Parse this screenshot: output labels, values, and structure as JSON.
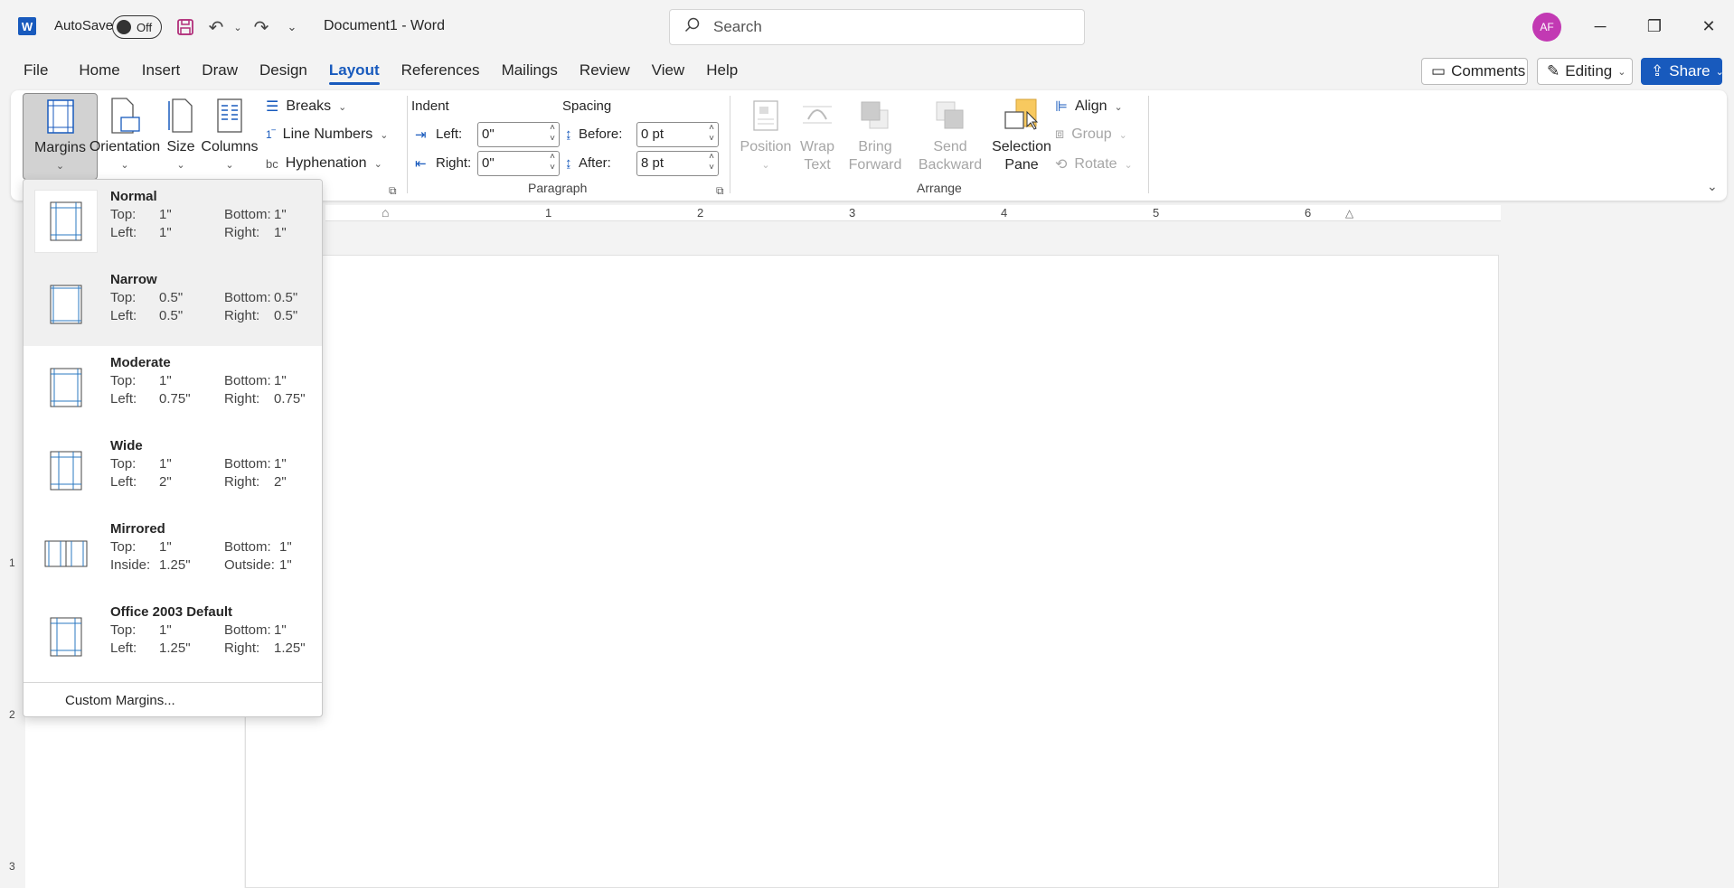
{
  "titlebar": {
    "app_icon": "W",
    "autosave_label": "AutoSave",
    "autosave_state": "Off",
    "doc_title": "Document1  -  Word",
    "search_placeholder": "Search",
    "avatar_initials": "AF"
  },
  "tabs": [
    "File",
    "Home",
    "Insert",
    "Draw",
    "Design",
    "Layout",
    "References",
    "Mailings",
    "Review",
    "View",
    "Help"
  ],
  "active_tab": "Layout",
  "right_buttons": {
    "comments": "Comments",
    "editing": "Editing",
    "share": "Share"
  },
  "ribbon": {
    "page_setup": {
      "margins": "Margins",
      "orientation": "Orientation",
      "size": "Size",
      "columns": "Columns",
      "breaks": "Breaks",
      "line_numbers": "Line Numbers",
      "hyphenation": "Hyphenation"
    },
    "paragraph": {
      "indent_label": "Indent",
      "spacing_label": "Spacing",
      "left_label": "Left:",
      "left_value": "0\"",
      "right_label": "Right:",
      "right_value": "0\"",
      "before_label": "Before:",
      "before_value": "0 pt",
      "after_label": "After:",
      "after_value": "8 pt",
      "group_label": "Paragraph"
    },
    "arrange": {
      "position": "Position",
      "wrap_text_1": "Wrap",
      "wrap_text_2": "Text",
      "bring_forward_1": "Bring",
      "bring_forward_2": "Forward",
      "send_backward_1": "Send",
      "send_backward_2": "Backward",
      "selection_pane_1": "Selection",
      "selection_pane_2": "Pane",
      "align": "Align",
      "group": "Group",
      "rotate": "Rotate",
      "group_label": "Arrange"
    }
  },
  "ruler": [
    "1",
    "2",
    "3",
    "4",
    "5",
    "6"
  ],
  "vruler": [
    "1",
    "2",
    "3"
  ],
  "margins_menu": {
    "options": [
      {
        "name": "Normal",
        "r1a": "Top:",
        "r1b": "1\"",
        "r1c": "Bottom:",
        "r1d": "1\"",
        "r2a": "Left:",
        "r2b": "1\"",
        "r2c": "Right:",
        "r2d": "1\""
      },
      {
        "name": "Narrow",
        "r1a": "Top:",
        "r1b": "0.5\"",
        "r1c": "Bottom:",
        "r1d": "0.5\"",
        "r2a": "Left:",
        "r2b": "0.5\"",
        "r2c": "Right:",
        "r2d": "0.5\""
      },
      {
        "name": "Moderate",
        "r1a": "Top:",
        "r1b": "1\"",
        "r1c": "Bottom:",
        "r1d": "1\"",
        "r2a": "Left:",
        "r2b": "0.75\"",
        "r2c": "Right:",
        "r2d": "0.75\""
      },
      {
        "name": "Wide",
        "r1a": "Top:",
        "r1b": "1\"",
        "r1c": "Bottom:",
        "r1d": "1\"",
        "r2a": "Left:",
        "r2b": "2\"",
        "r2c": "Right:",
        "r2d": "2\""
      },
      {
        "name": "Mirrored",
        "r1a": "Top:",
        "r1b": "1\"",
        "r1c": "Bottom:",
        "r1d": "1\"",
        "r2a": "Inside:",
        "r2b": "1.25\"",
        "r2c": "Outside:",
        "r2d": "1\""
      },
      {
        "name": "Office 2003 Default",
        "r1a": "Top:",
        "r1b": "1\"",
        "r1c": "Bottom:",
        "r1d": "1\"",
        "r2a": "Left:",
        "r2b": "1.25\"",
        "r2c": "Right:",
        "r2d": "1.25\""
      }
    ],
    "custom": "Custom Margins..."
  }
}
